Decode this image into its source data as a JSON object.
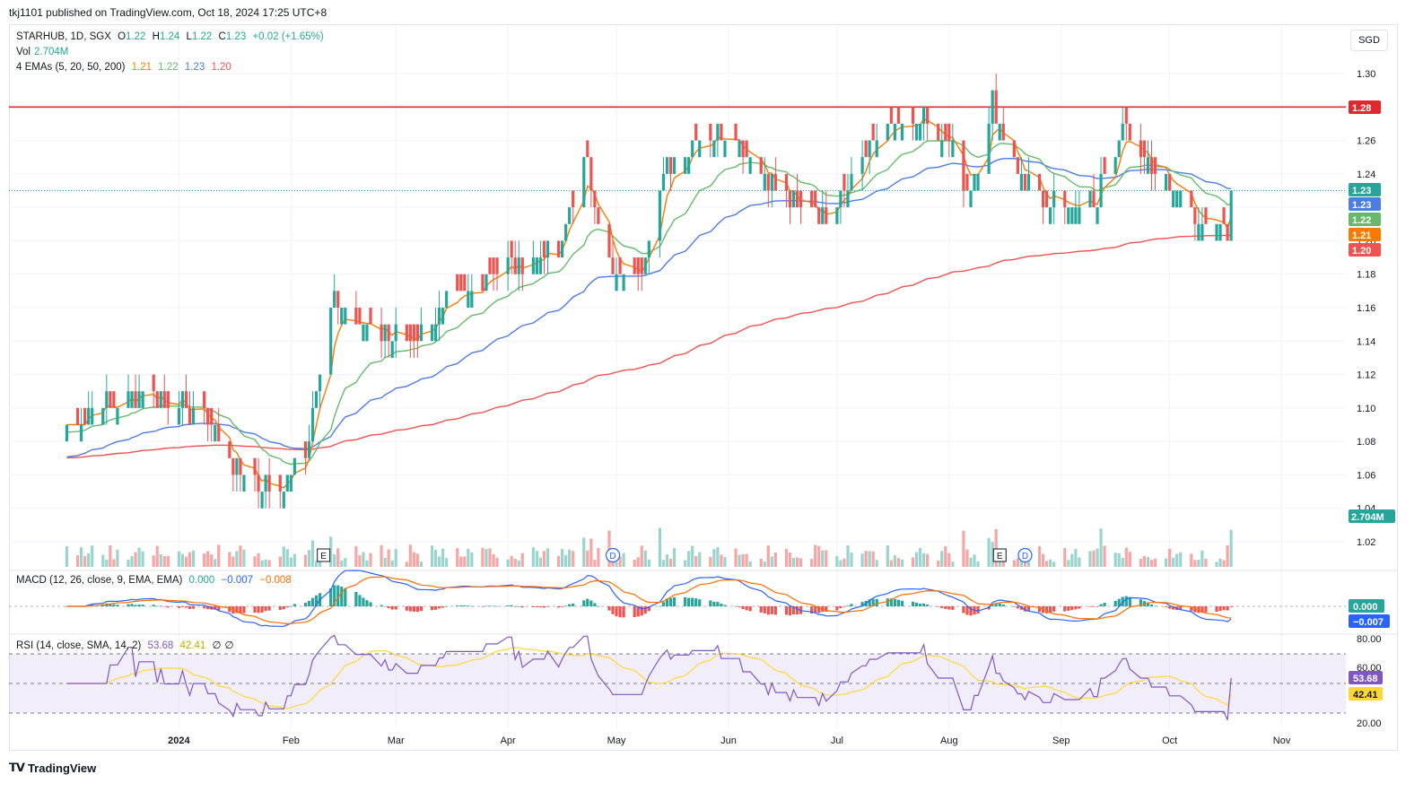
{
  "publisher": "tkj1101 published on TradingView.com, Oct 18, 2024 17:25 UTC+8",
  "currency": "SGD",
  "brand": "TradingView",
  "legend": {
    "symbol": "STARHUB, 1D, SGX",
    "o_label": "O",
    "o": "1.22",
    "h_label": "H",
    "h": "1.24",
    "l_label": "L",
    "l": "1.22",
    "c_label": "C",
    "c": "1.23",
    "change": "+0.02 (+1.65%)",
    "vol_label": "Vol",
    "vol": "2.704M",
    "ema_label": "4 EMAs (5, 20, 50, 200)",
    "ema5": "1.21",
    "ema20": "1.22",
    "ema50": "1.23",
    "ema200": "1.20",
    "macd_label": "MACD (12, 26, close, 9, EMA, EMA)",
    "macd_hist": "0.000",
    "macd": "−0.007",
    "macd_signal": "−0.008",
    "rsi_label": "RSI (14, close, SMA, 14, 2)",
    "rsi": "53.68",
    "rsi_ma": "42.41",
    "rsi_u": "∅",
    "rsi_l": "∅"
  },
  "colors": {
    "up": "#26a69a",
    "down": "#ef5350",
    "ema5": "#f57c00",
    "ema20": "#66bb6a",
    "ema50": "#4e7ce6",
    "ema200": "#ef5350",
    "resistance": "#e0282e",
    "macd": "#2962ff",
    "signal": "#ff6d00",
    "rsi": "#7e57c2",
    "rsi_ma": "#fdd835"
  },
  "chart_data": {
    "type": "candlestick",
    "price_axis": {
      "min": 1.02,
      "max": 1.3,
      "ticks": [
        "1.30",
        "1.28",
        "1.26",
        "1.24",
        "1.22",
        "1.20",
        "1.18",
        "1.16",
        "1.14",
        "1.12",
        "1.10",
        "1.08",
        "1.06",
        "1.04",
        "1.02"
      ]
    },
    "time_axis": [
      "2024",
      "Feb",
      "Mar",
      "Apr",
      "May",
      "Jun",
      "Jul",
      "Aug",
      "Sep",
      "Oct",
      "Nov"
    ],
    "resistance_line": 1.28,
    "price_labels": [
      {
        "text": "1.28",
        "value": 1.28,
        "color": "#e0282e"
      },
      {
        "text": "1.23",
        "value": 1.23,
        "color": "#26a69a"
      },
      {
        "text": "1.23",
        "value": 1.23,
        "color": "#4e7ce6"
      },
      {
        "text": "1.22",
        "value": 1.22,
        "color": "#66bb6a"
      },
      {
        "text": "1.21",
        "value": 1.21,
        "color": "#f57c00"
      },
      {
        "text": "1.20",
        "value": 1.2,
        "color": "#ef5350"
      }
    ],
    "volume_label": "2.704M",
    "events": [
      {
        "text": "E",
        "month": "Feb",
        "type": "earnings"
      },
      {
        "text": "D",
        "month": "May",
        "type": "dividend"
      },
      {
        "text": "E",
        "month": "Aug",
        "type": "earnings"
      },
      {
        "text": "D",
        "month": "Aug",
        "type": "dividend"
      }
    ],
    "close_anchors": [
      [
        "2023-12-01",
        1.09
      ],
      [
        "2023-12-10",
        1.1
      ],
      [
        "2023-12-20",
        1.11
      ],
      [
        "2024-01-02",
        1.1
      ],
      [
        "2024-01-10",
        1.09
      ],
      [
        "2024-01-18",
        1.06
      ],
      [
        "2024-01-28",
        1.05
      ],
      [
        "2024-02-05",
        1.07
      ],
      [
        "2024-02-09",
        1.12
      ],
      [
        "2024-02-13",
        1.17
      ],
      [
        "2024-02-22",
        1.15
      ],
      [
        "2024-03-05",
        1.14
      ],
      [
        "2024-03-20",
        1.17
      ],
      [
        "2024-04-05",
        1.19
      ],
      [
        "2024-04-15",
        1.19
      ],
      [
        "2024-04-22",
        1.25
      ],
      [
        "2024-04-30",
        1.18
      ],
      [
        "2024-05-07",
        1.18
      ],
      [
        "2024-05-14",
        1.24
      ],
      [
        "2024-05-22",
        1.26
      ],
      [
        "2024-06-01",
        1.27
      ],
      [
        "2024-06-10",
        1.24
      ],
      [
        "2024-06-20",
        1.22
      ],
      [
        "2024-06-28",
        1.22
      ],
      [
        "2024-07-05",
        1.24
      ],
      [
        "2024-07-15",
        1.27
      ],
      [
        "2024-07-25",
        1.27
      ],
      [
        "2024-08-01",
        1.26
      ],
      [
        "2024-08-06",
        1.22
      ],
      [
        "2024-08-13",
        1.28
      ],
      [
        "2024-08-20",
        1.24
      ],
      [
        "2024-08-28",
        1.22
      ],
      [
        "2024-09-05",
        1.22
      ],
      [
        "2024-09-12",
        1.23
      ],
      [
        "2024-09-18",
        1.27
      ],
      [
        "2024-09-26",
        1.24
      ],
      [
        "2024-10-03",
        1.23
      ],
      [
        "2024-10-10",
        1.21
      ],
      [
        "2024-10-17",
        1.21
      ],
      [
        "2024-10-18",
        1.23
      ]
    ],
    "ema_last": {
      "ema5": 1.21,
      "ema20": 1.22,
      "ema50": 1.23,
      "ema200": 1.2
    },
    "macd_axis": {
      "labels": [
        "0.000",
        "−0.007"
      ]
    },
    "rsi_axis": {
      "ticks": [
        "80.00",
        "60.00",
        "20.00"
      ],
      "bands": [
        70,
        50,
        30
      ],
      "last_rsi": 53.68,
      "last_ma": 42.41
    }
  }
}
